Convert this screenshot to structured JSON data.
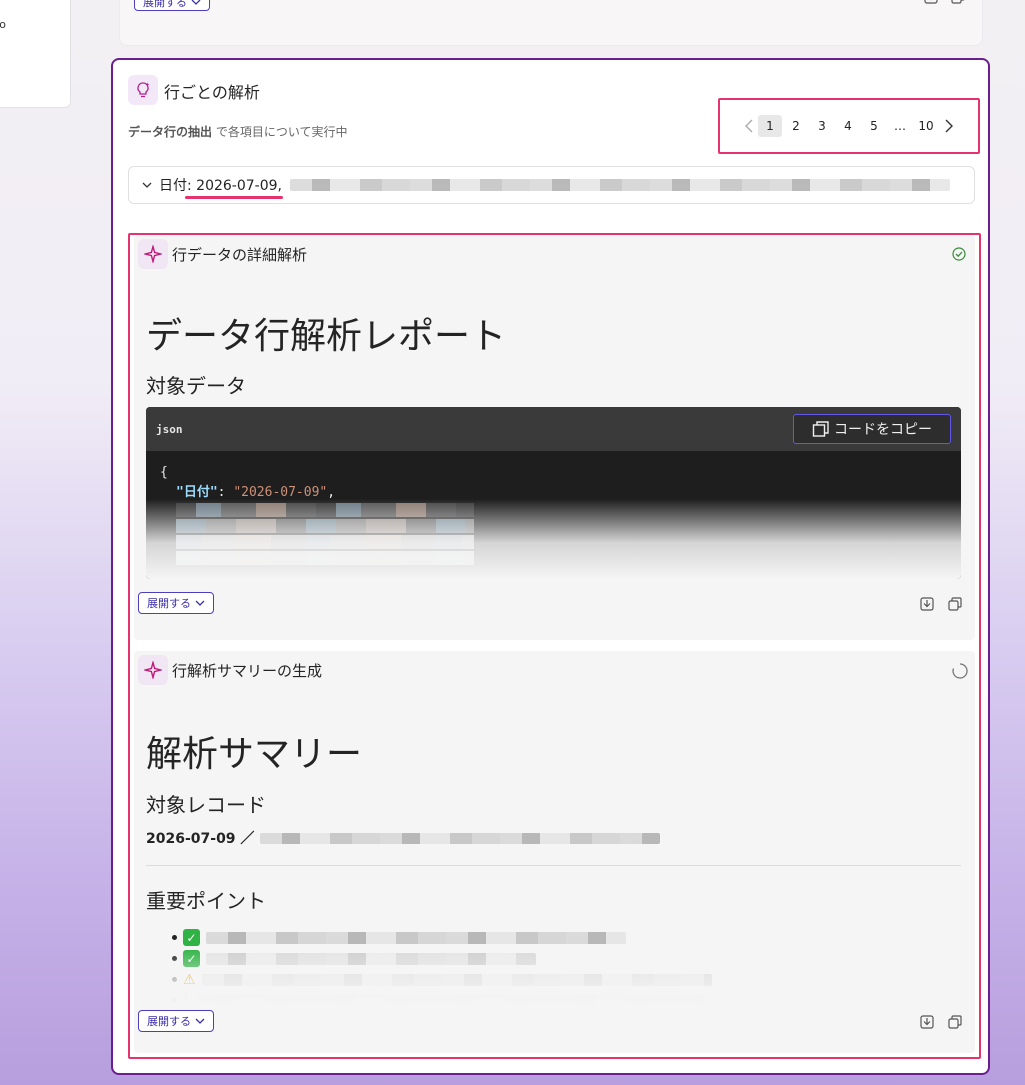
{
  "left_panel": {
    "fragment": "ro"
  },
  "prev_card": {
    "expand_label": "展開する"
  },
  "card": {
    "title": "行ごとの解析",
    "subtitle_bold": "データ行の抽出",
    "subtitle_rest": " で各項目について実行中",
    "pagination": {
      "pages": [
        "1",
        "2",
        "3",
        "4",
        "5",
        "…",
        "10"
      ],
      "active": "1"
    },
    "row_selector": {
      "label": "日付: 2026-07-09,"
    }
  },
  "steps": [
    {
      "title": "行データの詳細解析",
      "status": "complete",
      "h1": "データ行解析レポート",
      "h2": "対象データ",
      "code": {
        "lang": "json",
        "copy_label": "コードをコピー",
        "line1": "{",
        "key": "\"日付\"",
        "sep": ": ",
        "value": "\"2026-07-09\"",
        "comma": ","
      },
      "expand_label": "展開する"
    },
    {
      "title": "行解析サマリーの生成",
      "status": "running",
      "h1": "解析サマリー",
      "h2": "対象レコード",
      "record": "2026-07-09 ／",
      "h2b": "重要ポイント",
      "expand_label": "展開する"
    }
  ],
  "colors": {
    "accent_border": "#6c1e8f",
    "highlight": "#e5336e",
    "button": "#4b3fbf"
  },
  "icons": [
    "bulb-icon",
    "sparkle-icon",
    "check-circle-icon",
    "spinner-icon",
    "download-icon",
    "copy-icon",
    "chevron-left-icon",
    "chevron-right-icon",
    "chevron-down-icon"
  ]
}
